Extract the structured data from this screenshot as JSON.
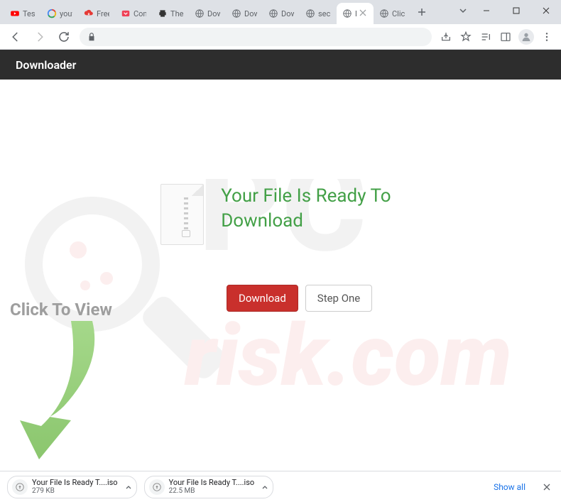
{
  "tabs": [
    {
      "title": "Tesla",
      "favicon": "youtube"
    },
    {
      "title": "yout",
      "favicon": "google"
    },
    {
      "title": "Free",
      "favicon": "cloud-red"
    },
    {
      "title": "Con",
      "favicon": "pocket"
    },
    {
      "title": "The",
      "favicon": "printer"
    },
    {
      "title": "Dow",
      "favicon": "globe"
    },
    {
      "title": "Dow",
      "favicon": "globe"
    },
    {
      "title": "Dow",
      "favicon": "globe"
    },
    {
      "title": "secu",
      "favicon": "globe"
    },
    {
      "title": "D",
      "favicon": "globe",
      "active": true
    },
    {
      "title": "Click",
      "favicon": "globe"
    }
  ],
  "header": {
    "title": "Downloader"
  },
  "main": {
    "headline": "Your File Is Ready To Download",
    "download_label": "Download",
    "step_one_label": "Step One"
  },
  "overlay": {
    "click_to_view": "Click To View"
  },
  "downloads_bar": {
    "items": [
      {
        "name": "Your File Is Ready T....iso",
        "size": "279 KB"
      },
      {
        "name": "Your File Is Ready T....iso",
        "size": "22.5 MB"
      }
    ],
    "show_all_label": "Show all"
  }
}
